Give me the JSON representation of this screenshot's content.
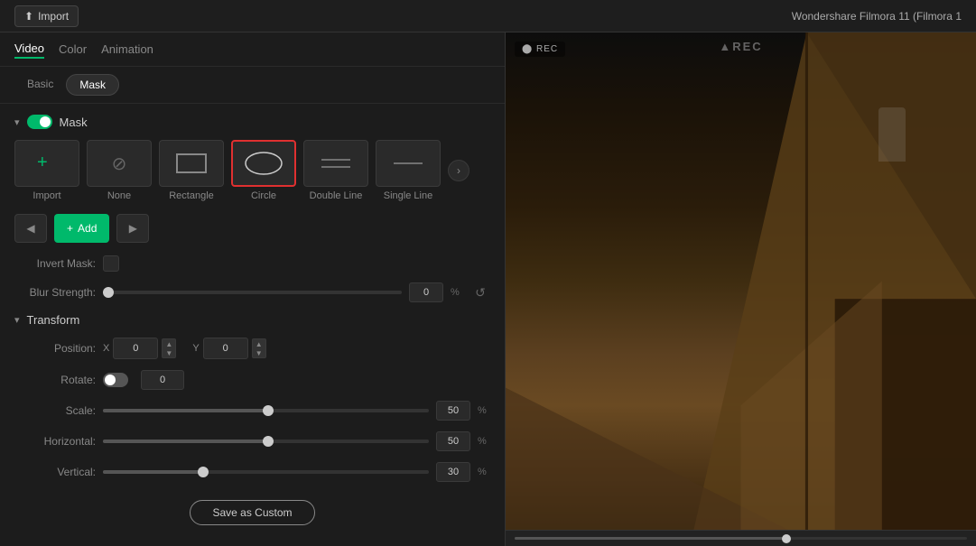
{
  "app": {
    "title": "Wondershare Filmora 11 (Filmora 1"
  },
  "topbar": {
    "import_label": "Import"
  },
  "tabs": {
    "video_label": "Video",
    "color_label": "Color",
    "animation_label": "Animation"
  },
  "sub_tabs": {
    "basic_label": "Basic",
    "mask_label": "Mask"
  },
  "mask_section": {
    "label": "Mask",
    "enabled": true
  },
  "mask_options": [
    {
      "id": "import",
      "label": "Import",
      "type": "import"
    },
    {
      "id": "none",
      "label": "None",
      "type": "none"
    },
    {
      "id": "rectangle",
      "label": "Rectangle",
      "type": "rect"
    },
    {
      "id": "circle",
      "label": "Circle",
      "type": "circle",
      "selected": true
    },
    {
      "id": "double_line",
      "label": "Double Line",
      "type": "double"
    },
    {
      "id": "single_line",
      "label": "Single Line",
      "type": "single"
    }
  ],
  "action_buttons": {
    "add_label": "+ Add"
  },
  "invert_mask": {
    "label": "Invert Mask:"
  },
  "blur_strength": {
    "label": "Blur Strength:",
    "value": "0",
    "unit": "%",
    "slider_pct": 0
  },
  "transform": {
    "label": "Transform",
    "position_label": "Position:",
    "x_label": "X",
    "x_value": "0",
    "y_label": "Y",
    "y_value": "0",
    "rotate_label": "Rotate:",
    "rotate_value": "0",
    "scale_label": "Scale:",
    "scale_value": "50",
    "scale_unit": "%",
    "scale_pct": 50,
    "horizontal_label": "Horizontal:",
    "horizontal_value": "50",
    "horizontal_unit": "%",
    "horizontal_pct": 50,
    "vertical_label": "Vertical:",
    "vertical_value": "30",
    "vertical_unit": "%",
    "vertical_pct": 30
  },
  "save_btn": {
    "label": "Save as Custom"
  }
}
